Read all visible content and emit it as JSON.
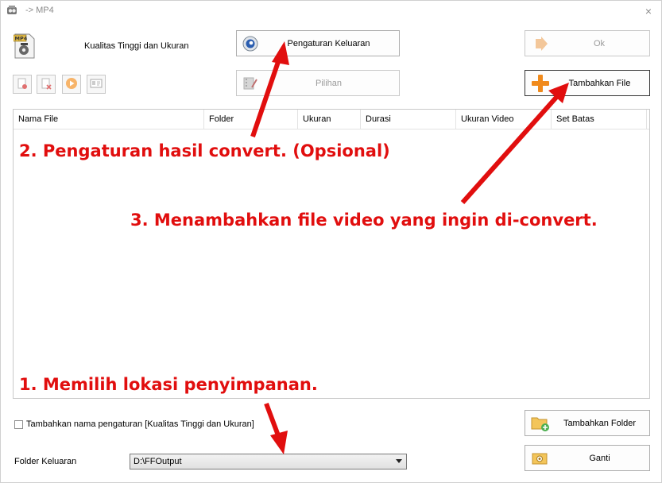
{
  "window": {
    "title": "-> MP4",
    "close_glyph": "×"
  },
  "profile": {
    "label": "Kualitas Tinggi dan Ukuran",
    "icon": "mp4-file-icon"
  },
  "buttons": {
    "output_settings": "Pengaturan Keluaran",
    "options": "Pilihan",
    "ok": "Ok",
    "add_file": "Tambahkan File",
    "add_folder": "Tambahkan Folder",
    "change": "Ganti"
  },
  "toolbar_icons": [
    "remove-item-icon",
    "clear-list-icon",
    "play-icon",
    "media-info-icon"
  ],
  "file_list": {
    "columns": [
      "Nama File",
      "Folder",
      "Ukuran",
      "Durasi",
      "Ukuran Video",
      "Set Batas"
    ],
    "rows": []
  },
  "options": {
    "append_setting_name_label": "Tambahkan nama pengaturan [Kualitas Tinggi dan Ukuran]",
    "append_setting_name_checked": false
  },
  "output_folder": {
    "label": "Folder Keluaran",
    "value": "D:\\FFOutput"
  },
  "annotations": {
    "step2": "2. Pengaturan hasil convert. (Opsional)",
    "step3": "3. Menambahkan file video yang ingin di-convert.",
    "step1": "1. Memilih lokasi penyimpanan."
  },
  "colors": {
    "annotation": "#e10e0e",
    "accent_orange": "#f08a1c"
  }
}
